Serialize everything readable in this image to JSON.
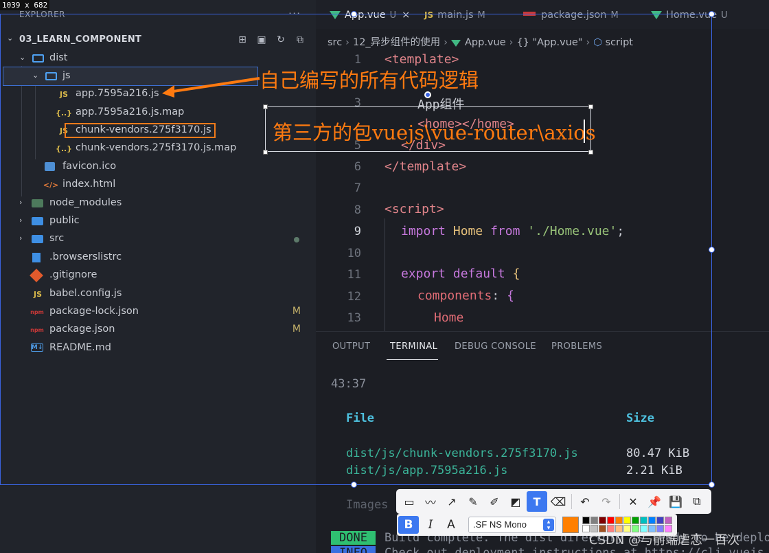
{
  "screen_size_label": "1039 x 682",
  "explorer": {
    "header": "EXPLORER",
    "more": "···",
    "root": "03_LEARN_COMPONENT",
    "items": [
      {
        "name": "dist",
        "kind": "folder-open"
      },
      {
        "name": "js",
        "kind": "folder-open"
      },
      {
        "name": "app.7595a216.js",
        "kind": "js"
      },
      {
        "name": "app.7595a216.js.map",
        "kind": "json"
      },
      {
        "name": "chunk-vendors.275f3170.js",
        "kind": "js"
      },
      {
        "name": "chunk-vendors.275f3170.js.map",
        "kind": "json"
      },
      {
        "name": "favicon.ico",
        "kind": "image"
      },
      {
        "name": "index.html",
        "kind": "html"
      },
      {
        "name": "node_modules",
        "kind": "folder"
      },
      {
        "name": "public",
        "kind": "folder"
      },
      {
        "name": "src",
        "kind": "folder"
      },
      {
        "name": ".browserslistrc",
        "kind": "file"
      },
      {
        "name": ".gitignore",
        "kind": "git"
      },
      {
        "name": "babel.config.js",
        "kind": "js"
      },
      {
        "name": "package-lock.json",
        "kind": "npm",
        "badge": "M"
      },
      {
        "name": "package.json",
        "kind": "npm",
        "badge": "M"
      },
      {
        "name": "README.md",
        "kind": "md"
      }
    ]
  },
  "tabs": [
    {
      "label": "App.vue",
      "mod": "U",
      "close": "×"
    },
    {
      "label": "main.js",
      "mod": "M"
    },
    {
      "label": "package.json",
      "mod": "M"
    },
    {
      "label": "Home.vue",
      "mod": "U"
    }
  ],
  "breadcrumb": [
    "src",
    "12_异步组件的使用",
    "App.vue",
    "{} \"App.vue\"",
    "script"
  ],
  "code_lines": [
    {
      "n": "1",
      "text": "<template>"
    },
    {
      "n": "3",
      "text": "App组件"
    },
    {
      "n": "",
      "text": "<home></home>"
    },
    {
      "n": "5",
      "text": "</div>"
    },
    {
      "n": "6",
      "text": "</template>"
    },
    {
      "n": "7",
      "text": ""
    },
    {
      "n": "8",
      "text": "<script>"
    },
    {
      "n": "9",
      "text": "import Home from './Home.vue';"
    },
    {
      "n": "10",
      "text": ""
    },
    {
      "n": "11",
      "text": "export default {"
    },
    {
      "n": "12",
      "text": "components: {"
    },
    {
      "n": "13",
      "text": "Home"
    }
  ],
  "panel": {
    "tabs": [
      "OUTPUT",
      "TERMINAL",
      "DEBUG CONSOLE",
      "PROBLEMS"
    ],
    "active_tab": "TERMINAL",
    "time": "43:37",
    "col_file": "File",
    "col_size": "Size",
    "rows": [
      {
        "file": "dist/js/chunk-vendors.275f3170.js",
        "size": "80.47 KiB"
      },
      {
        "file": "dist/js/app.7595a216.js",
        "size": "2.21 KiB"
      }
    ],
    "images_text": "Images",
    "done_badge": "DONE",
    "done_text": "Build complete. The dist directory is ready to be deployed.",
    "info_badge": "INFO",
    "info_text": "Check out deployment instructions at https://cli.vuejs.org"
  },
  "annotations": {
    "arrow_note": "自己编写的所有代码逻辑",
    "box_note": "第三方的包vuejs\\vue-router\\axios"
  },
  "toolbar": {
    "font": ".SF NS Mono",
    "bold": "B",
    "italic": "I",
    "outline": "A",
    "text_tool": "T",
    "current_color": "#ff7f00",
    "palette": [
      "#000000",
      "#808080",
      "#800000",
      "#ff0000",
      "#ff8000",
      "#ffff00",
      "#00a000",
      "#00c0c0",
      "#0080ff",
      "#4040c0",
      "#c060c0",
      "#ffffff",
      "#c0c0c0",
      "#a05020",
      "#ff8080",
      "#ffc080",
      "#ffff80",
      "#80ff80",
      "#80ffff",
      "#80c0ff",
      "#8080ff",
      "#ff80ff"
    ]
  },
  "watermark": "CSDN @与前端虐恋一百次"
}
